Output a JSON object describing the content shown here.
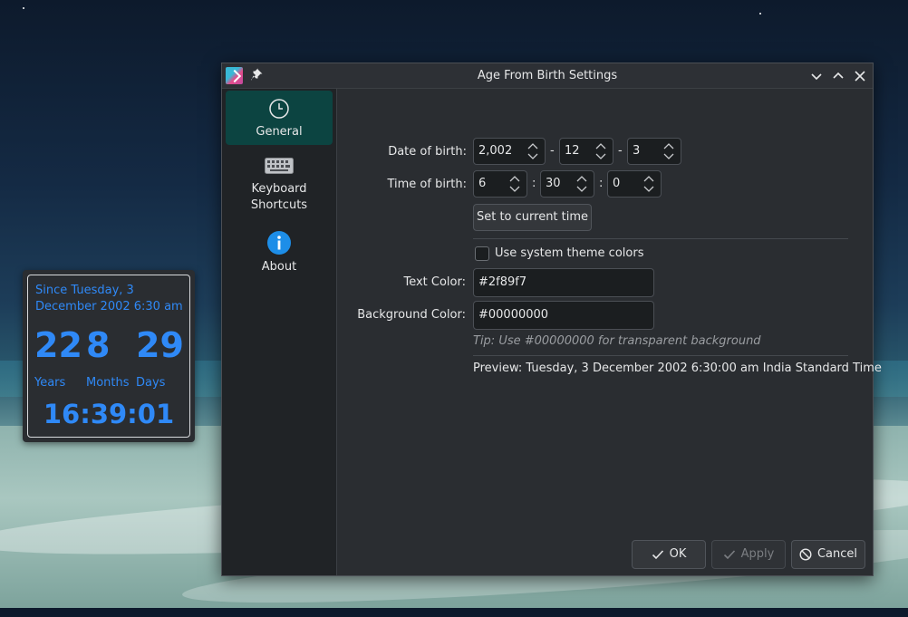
{
  "widget": {
    "since_text": "Since Tuesday, 3 December 2002 6:30 am",
    "years_value": "22",
    "months_value": "8",
    "days_value": "29",
    "years_label": "Years",
    "months_label": "Months",
    "days_label": "Days",
    "clock": "16:39:01",
    "text_color": "#2f89f7"
  },
  "window": {
    "title": "Age From Birth Settings",
    "sidebar": {
      "items": [
        {
          "label": "General",
          "icon": "clock-icon",
          "active": true
        },
        {
          "label": "Keyboard\nShortcuts",
          "icon": "keyboard-icon",
          "active": false
        },
        {
          "label": "About",
          "icon": "info-icon",
          "active": false
        }
      ]
    },
    "form": {
      "date_label": "Date of birth:",
      "date_year": "2,002",
      "date_month": "12",
      "date_day": "3",
      "date_separator": "-",
      "time_label": "Time of birth:",
      "time_hour": "6",
      "time_minute": "30",
      "time_second": "0",
      "time_separator": ":",
      "set_current_button": "Set to current time",
      "system_theme_label": "Use system theme colors",
      "system_theme_checked": false,
      "text_color_label": "Text Color:",
      "text_color_value": "#2f89f7",
      "bg_color_label": "Background Color:",
      "bg_color_value": "#00000000",
      "tip": "Tip: Use #00000000 for transparent background",
      "preview": "Preview: Tuesday, 3 December 2002 6:30:00 am India Standard Time"
    },
    "buttons": {
      "ok": "OK",
      "apply": "Apply",
      "cancel": "Cancel"
    },
    "accent_color": "#0c4441"
  }
}
